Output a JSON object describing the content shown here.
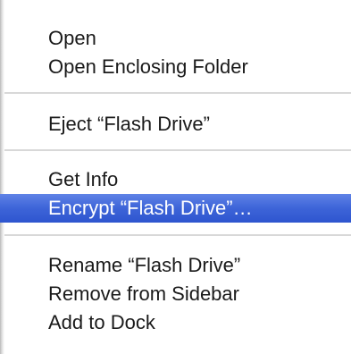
{
  "context_menu": {
    "groups": [
      {
        "items": [
          {
            "label": "Open"
          },
          {
            "label": "Open Enclosing Folder"
          }
        ]
      },
      {
        "items": [
          {
            "label": "Eject “Flash Drive”"
          }
        ]
      },
      {
        "items": [
          {
            "label": "Get Info"
          },
          {
            "label": "Encrypt “Flash Drive”…",
            "highlighted": true
          }
        ]
      },
      {
        "items": [
          {
            "label": "Rename “Flash Drive”"
          },
          {
            "label": "Remove from Sidebar"
          },
          {
            "label": "Add to Dock"
          }
        ]
      }
    ]
  },
  "colors": {
    "highlight": "#3d64d8",
    "separator": "#d8d8d8",
    "text": "#1a1a1a",
    "highlight_text": "#ffffff"
  }
}
